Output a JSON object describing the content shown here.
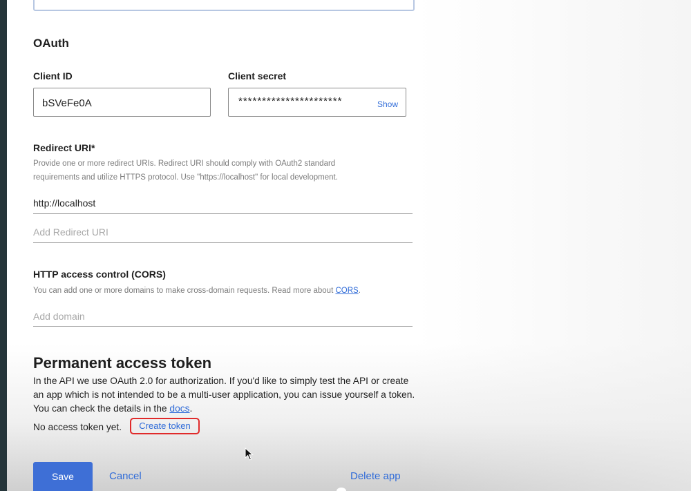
{
  "oauth": {
    "section_title": "OAuth",
    "client_id_label": "Client ID",
    "client_id_value": "bSVeFe0A",
    "client_secret_label": "Client secret",
    "client_secret_value": "**********************",
    "show_label": "Show"
  },
  "redirect": {
    "label": "Redirect URI*",
    "help_line1": "Provide one or more redirect URIs. Redirect URI should comply with OAuth2 standard",
    "help_line2": "requirements and utilize HTTPS protocol. Use \"https://localhost\" for local development.",
    "value": "http://localhost",
    "placeholder": "Add Redirect URI"
  },
  "cors": {
    "label": "HTTP access control (CORS)",
    "help_text": "You can add one or more domains to make cross-domain requests. Read more about ",
    "help_link": "CORS",
    "help_end": ".",
    "placeholder": "Add domain"
  },
  "token": {
    "title": "Permanent access token",
    "paragraph": "In the API we use OAuth 2.0 for authorization. If you'd like to simply test the API or create an app which is not intended to be a multi-user application, you can issue yourself a token. You can check the details in the ",
    "docs_link": "docs",
    "paragraph_end": ".",
    "status": "No access token yet.",
    "create_label": "Create token"
  },
  "footer": {
    "save_label": "Save",
    "cancel_label": "Cancel",
    "delete_label": "Delete app"
  },
  "colors": {
    "accent": "#3e6fd6",
    "link": "#2f6bd8",
    "highlight": "#e02a2a"
  }
}
